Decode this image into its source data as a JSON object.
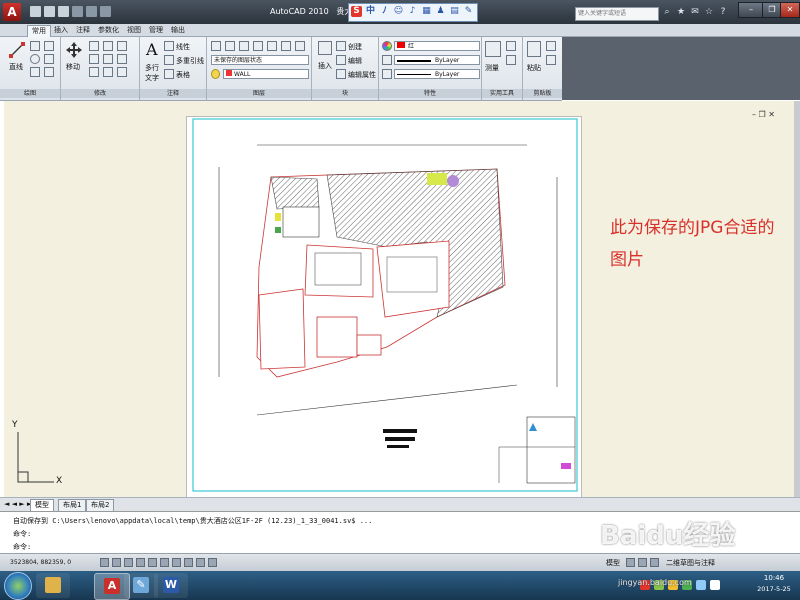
{
  "window": {
    "title": "AutoCAD 2010",
    "file_title": "贵大酒店"
  },
  "search": {
    "placeholder": "键入关键字或短语"
  },
  "ime": {
    "s": "S",
    "zh": "中"
  },
  "ribbon": {
    "tabs": [
      "常用",
      "插入",
      "注释",
      "参数化",
      "视图",
      "管理",
      "输出"
    ],
    "active_tab": "常用",
    "draw": {
      "line": "直线",
      "title": "绘图"
    },
    "modify": {
      "move": "移动",
      "title": "修改"
    },
    "annotate": {
      "mtext": "多行",
      "mtext2": "文字",
      "linear": "线性",
      "multileader": "多重引线",
      "table": "表格",
      "title": "注释"
    },
    "layers": {
      "state": "未保存的图层状态",
      "current": "WALL",
      "title": "图层"
    },
    "block": {
      "insert": "插入",
      "create": "创建",
      "edit": "编辑",
      "attr": "编辑属性",
      "title": "块"
    },
    "properties": {
      "color": "红",
      "linetype": "ByLayer",
      "lineweight": "ByLayer",
      "title": "特性"
    },
    "utilities": {
      "measure": "测量",
      "title": "实用工具"
    },
    "clipboard": {
      "paste": "粘贴",
      "title": "剪贴板"
    }
  },
  "annotation": "此为保存的JPG合适的图片",
  "layout_tabs": [
    "模型",
    "布局1",
    "布局2"
  ],
  "command": {
    "lines": [
      "自动保存到 C:\\Users\\lenovo\\appdata\\local\\temp\\贵大酒店公区1F-2F (12.23)_1_33_0041.sv$ ...",
      "命令:",
      "命令:"
    ]
  },
  "status": {
    "coords": "3523804, 882359, 0",
    "model": "模型",
    "workspace": "二维草图与注释"
  },
  "taskbar": {
    "time": "10:46",
    "date": "2017-5-25"
  },
  "watermark": {
    "text": "Baidu经验",
    "sub": "jingyan.baidu.com"
  },
  "ucs": {
    "y": "Y",
    "x": "X"
  },
  "colors": {
    "accent_red": "#d8312b",
    "canvas": "#f3f0df",
    "title_bar": "#3a434d",
    "taskbar": "#1f4a6e"
  }
}
